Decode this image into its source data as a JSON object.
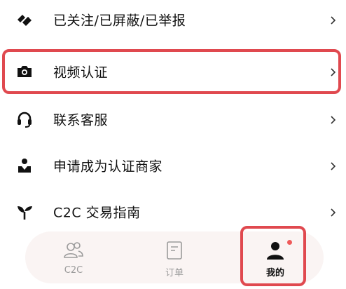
{
  "menu": {
    "items": [
      {
        "label": "已关注/已屏蔽/已举报",
        "icon": "tags-icon"
      },
      {
        "label": "视频认证",
        "icon": "camera-icon"
      },
      {
        "label": "联系客服",
        "icon": "headset-icon"
      },
      {
        "label": "申请成为认证商家",
        "icon": "merchant-icon"
      },
      {
        "label": "C2C 交易指南",
        "icon": "sprout-icon"
      }
    ]
  },
  "tabbar": {
    "tabs": [
      {
        "label": "C2C",
        "icon": "users-icon"
      },
      {
        "label": "订单",
        "icon": "order-icon"
      },
      {
        "label": "我的",
        "icon": "profile-icon"
      }
    ]
  },
  "colors": {
    "highlight": "#e0494f",
    "tabbar_bg": "#faf4f3",
    "badge": "#ef5a5a"
  }
}
